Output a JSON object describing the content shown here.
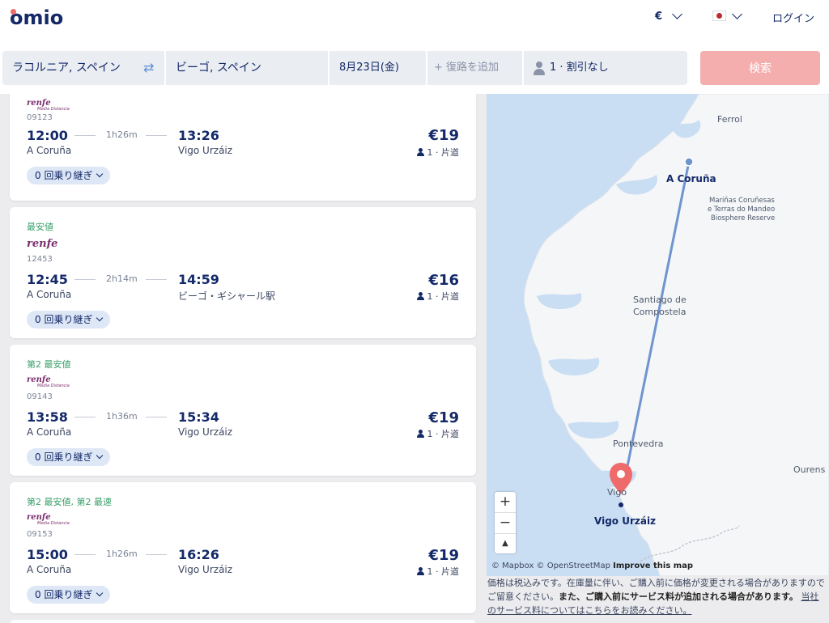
{
  "header": {
    "logo": "omio",
    "currency": "€",
    "login": "ログイン"
  },
  "search": {
    "origin": "ラコルニア, スペイン",
    "destination": "ビーゴ, スペイン",
    "date": "8月23日(金)",
    "return_placeholder": "+ 復路を追加",
    "passengers": "1 · 割引なし",
    "button": "検索"
  },
  "results": [
    {
      "tag": "",
      "carrier": "renfe",
      "carrier_sub": "Media Distancia",
      "train_no": "09123",
      "dep_time": "12:00",
      "duration": "1h26m",
      "arr_time": "13:26",
      "dep_station": "A Coruña",
      "arr_station": "Vigo Urzáiz",
      "price": "€19",
      "pax": "1 · 片道",
      "transfers": "0 回乗り継ぎ"
    },
    {
      "tag": "最安値",
      "carrier": "renfe",
      "carrier_sub": "",
      "train_no": "12453",
      "dep_time": "12:45",
      "duration": "2h14m",
      "arr_time": "14:59",
      "dep_station": "A Coruña",
      "arr_station": "ビーゴ・ギシャール駅",
      "price": "€16",
      "pax": "1 · 片道",
      "transfers": "0 回乗り継ぎ"
    },
    {
      "tag": "第2 最安値",
      "carrier": "renfe",
      "carrier_sub": "Media Distancia",
      "train_no": "09143",
      "dep_time": "13:58",
      "duration": "1h36m",
      "arr_time": "15:34",
      "dep_station": "A Coruña",
      "arr_station": "Vigo Urzáiz",
      "price": "€19",
      "pax": "1 · 片道",
      "transfers": "0 回乗り継ぎ"
    },
    {
      "tag": "第2 最安値, 第2 最速",
      "carrier": "renfe",
      "carrier_sub": "Media Distancia",
      "train_no": "09153",
      "dep_time": "15:00",
      "duration": "1h26m",
      "arr_time": "16:26",
      "dep_station": "A Coruña",
      "arr_station": "Vigo Urzáiz",
      "price": "€19",
      "pax": "1 · 片道",
      "transfers": "0 回乗り継ぎ"
    }
  ],
  "map": {
    "labels": {
      "ferrol": "Ferrol",
      "coruna": "A Coruña",
      "marinas": [
        "Mariñas Coruñesas",
        "e Terras do Mandeo",
        "Biosphere Reserve"
      ],
      "santiago": [
        "Santiago de",
        "Compostela"
      ],
      "pontevedra": "Pontevedra",
      "vigo": "Vigo",
      "vigo_urzaiz": "Vigo Urzáiz",
      "ourense": "Ourens"
    },
    "zoom_in": "+",
    "zoom_out": "−",
    "compass": "▲",
    "attribution": "© Mapbox © OpenStreetMap",
    "improve": "Improve this map",
    "colors": {
      "water": "#c9ddf3",
      "land": "#f4f6f8",
      "route": "#6f94cf",
      "pin": "#ef6b6b"
    }
  },
  "disclaimer": {
    "part1": "価格は税込みです。在庫量に伴い、ご購入前に価格が変更される場合がありますのでご留意ください。",
    "part2": "また、ご購入前にサービス料が追加される場合があります。",
    "link": "当社のサービス料についてはこちらをお読みください。"
  }
}
